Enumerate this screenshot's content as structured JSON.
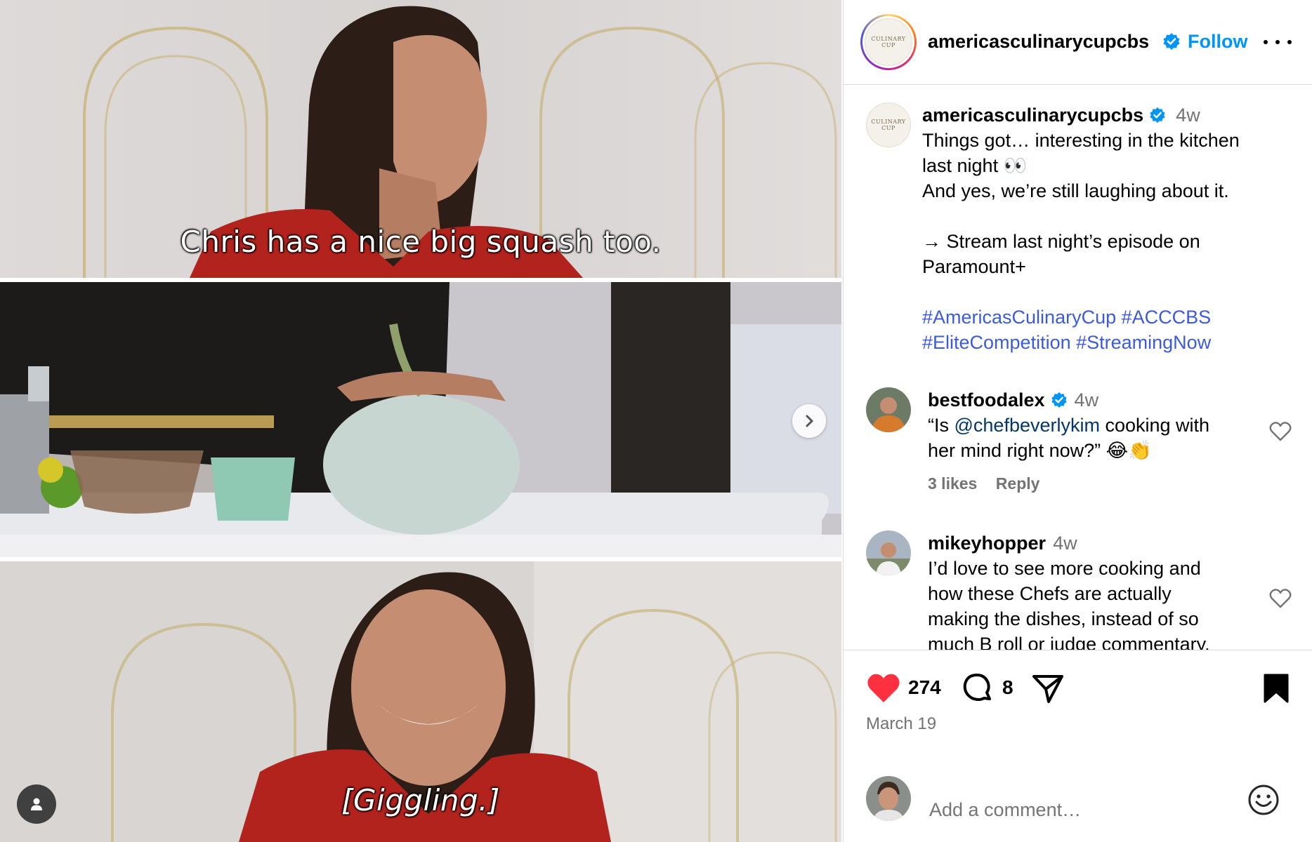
{
  "media": {
    "caption_top": "Chris has a nice big squash too.",
    "caption_bottom": "[Giggling.]"
  },
  "header": {
    "username": "americasculinarycupcbs",
    "follow_label": "Follow",
    "logo_text_1": "CULINARY",
    "logo_text_2": "CUP"
  },
  "caption": {
    "username": "americasculinarycupcbs",
    "time": "4w",
    "lines": [
      "Things got… interesting in the kitchen",
      "last night 👀",
      "And yes, we’re still laughing about it.",
      "",
      "→ Stream last night’s episode on",
      "Paramount+",
      ""
    ],
    "hashtags_line1": "#AmericasCulinaryCup #ACCCBS",
    "hashtags_line2": "#EliteCompetition #StreamingNow"
  },
  "comments": [
    {
      "username": "bestfoodalex",
      "time": "4w",
      "prefix": "“Is ",
      "mention": "@chefbeverlykim",
      "suffix": " cooking with",
      "line2": "her mind right now?” 😂👏",
      "likes": "3 likes",
      "reply": "Reply"
    },
    {
      "username": "mikeyhopper",
      "time": "4w",
      "line1": "I’d love to see more cooking and",
      "line2": "how these Chefs are actually",
      "line3": "making the dishes, instead of so",
      "line4": "much B roll or judge commentary."
    }
  ],
  "actions": {
    "like_count": "274",
    "comment_count": "8",
    "date": "March 19"
  },
  "composer": {
    "placeholder": "Add a comment…"
  },
  "colors": {
    "accent": "#0095f6",
    "heart": "#ff3040",
    "hashtag": "#3b5bdb",
    "verified": "#0095f6"
  },
  "icons": [
    "chevron-right-icon",
    "user-tag-icon",
    "verified-icon",
    "more-icon",
    "heart-filled-icon",
    "comment-icon",
    "share-icon",
    "bookmark-filled-icon",
    "heart-outline-icon",
    "emoji-icon"
  ]
}
